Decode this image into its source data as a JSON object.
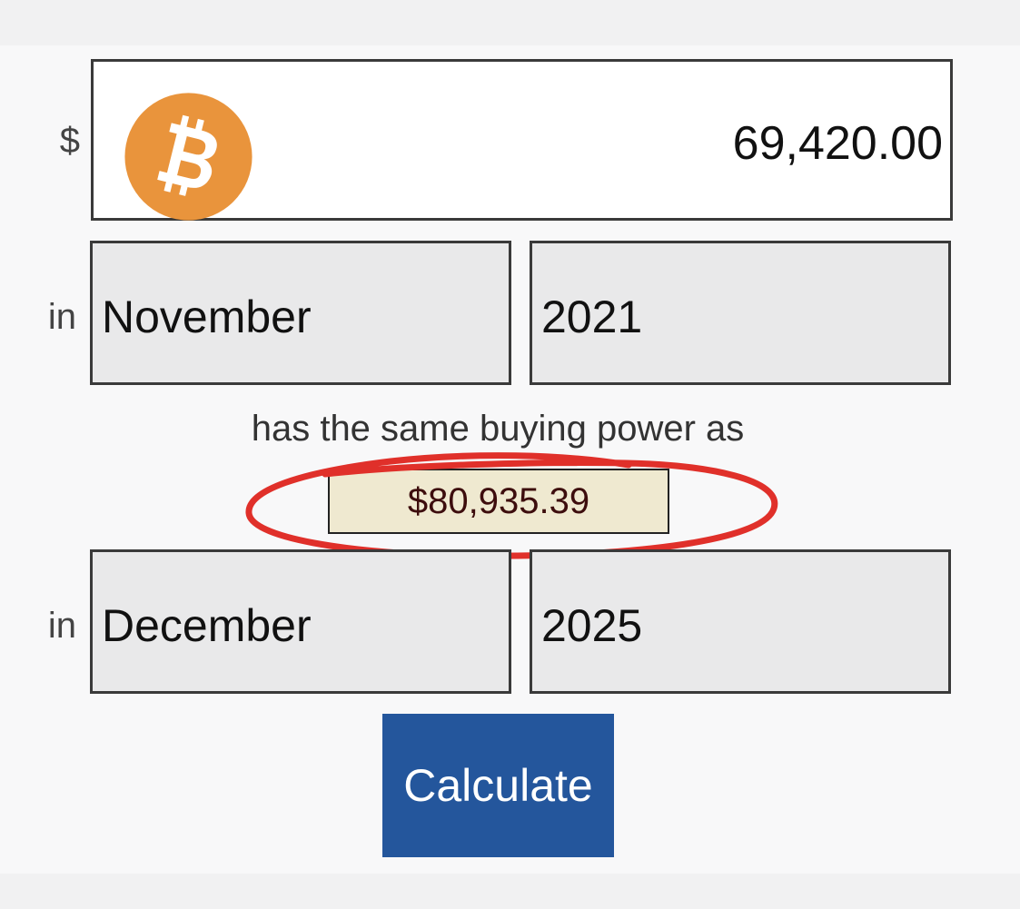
{
  "amount": {
    "currency_symbol": "$",
    "value": "69,420.00",
    "icon": "bitcoin-logo"
  },
  "from": {
    "prefix": "in",
    "month": "November",
    "year": "2021"
  },
  "caption": "has the same buying power as",
  "result": {
    "value": "$80,935.39"
  },
  "to": {
    "prefix": "in",
    "month": "December",
    "year": "2025"
  },
  "calculate_label": "Calculate",
  "colors": {
    "bitcoin_orange": "#e9943c",
    "button_blue": "#24569c",
    "result_bg": "#efe9d0",
    "annotation_red": "#e0302a"
  }
}
